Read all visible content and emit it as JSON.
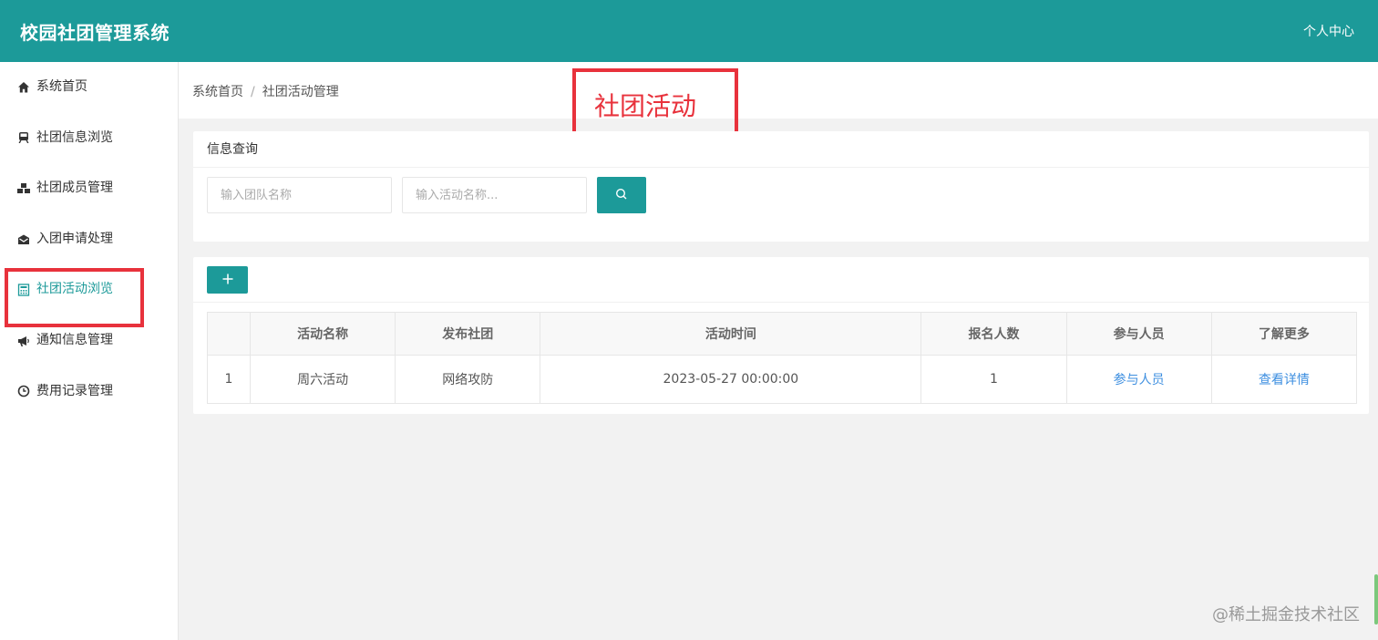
{
  "header": {
    "title": "校园社团管理系统",
    "user_center": "个人中心"
  },
  "sidebar": {
    "items": [
      {
        "label": "系统首页",
        "icon": "home-icon"
      },
      {
        "label": "社团信息浏览",
        "icon": "train-icon"
      },
      {
        "label": "社团成员管理",
        "icon": "cubes-icon"
      },
      {
        "label": "入团申请处理",
        "icon": "envelope-icon"
      },
      {
        "label": "社团活动浏览",
        "icon": "calculator-icon",
        "active": true
      },
      {
        "label": "通知信息管理",
        "icon": "bullhorn-icon"
      },
      {
        "label": "费用记录管理",
        "icon": "clock-icon"
      }
    ]
  },
  "breadcrumb": {
    "home": "系统首页",
    "separator": "/",
    "current": "社团活动管理"
  },
  "annotation": {
    "title": "社团活动"
  },
  "query": {
    "heading": "信息查询",
    "team_placeholder": "输入团队名称",
    "activity_placeholder": "输入活动名称..."
  },
  "table": {
    "columns": [
      "",
      "活动名称",
      "发布社团",
      "活动时间",
      "报名人数",
      "参与人员",
      "了解更多"
    ],
    "rows": [
      {
        "index": "1",
        "name": "周六活动",
        "club": "网络攻防",
        "time": "2023-05-27 00:00:00",
        "count": "1",
        "participants": "参与人员",
        "details": "查看详情"
      }
    ]
  },
  "watermark": "@稀土掘金技术社区",
  "colors": {
    "primary": "#1c9a99",
    "annotation_red": "#e8323c",
    "link": "#3e8fe0"
  }
}
